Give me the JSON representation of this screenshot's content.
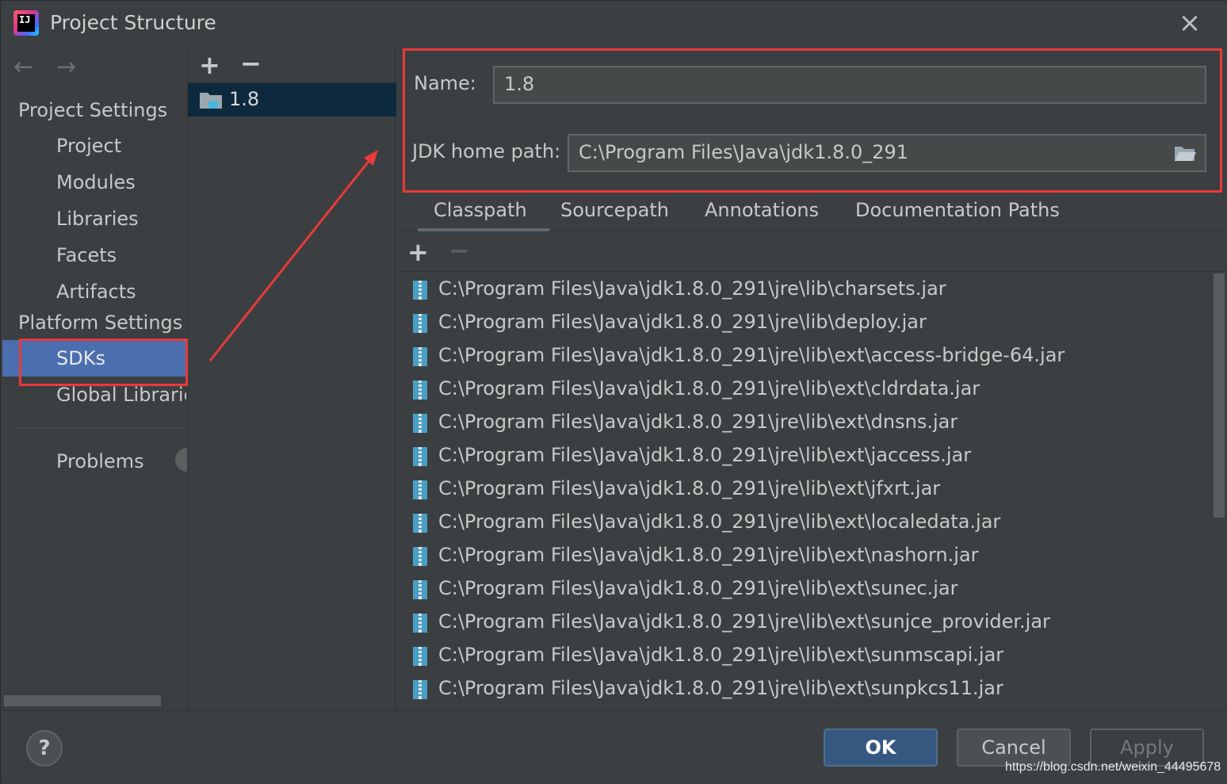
{
  "window": {
    "title": "Project Structure",
    "app_icon_text": "IJ"
  },
  "nav": {
    "back_arrow": "←",
    "forward_arrow": "→",
    "project_settings_header": "Project Settings",
    "project_items": [
      "Project",
      "Modules",
      "Libraries",
      "Facets",
      "Artifacts"
    ],
    "platform_settings_header": "Platform Settings",
    "sdks": "SDKs",
    "global_libraries": "Global Librarie",
    "problems": "Problems"
  },
  "sdk_list": {
    "add": "+",
    "remove": "−",
    "items": [
      "1.8"
    ]
  },
  "sdk_detail": {
    "name_label": "Name:",
    "name_value": "1.8",
    "jdk_label": "JDK home path:",
    "jdk_value": "C:\\Program Files\\Java\\jdk1.8.0_291"
  },
  "tabs": [
    "Classpath",
    "Sourcepath",
    "Annotations",
    "Documentation Paths"
  ],
  "classpath_toolbar": {
    "add": "+",
    "remove": "−"
  },
  "classpath": [
    "C:\\Program Files\\Java\\jdk1.8.0_291\\jre\\lib\\charsets.jar",
    "C:\\Program Files\\Java\\jdk1.8.0_291\\jre\\lib\\deploy.jar",
    "C:\\Program Files\\Java\\jdk1.8.0_291\\jre\\lib\\ext\\access-bridge-64.jar",
    "C:\\Program Files\\Java\\jdk1.8.0_291\\jre\\lib\\ext\\cldrdata.jar",
    "C:\\Program Files\\Java\\jdk1.8.0_291\\jre\\lib\\ext\\dnsns.jar",
    "C:\\Program Files\\Java\\jdk1.8.0_291\\jre\\lib\\ext\\jaccess.jar",
    "C:\\Program Files\\Java\\jdk1.8.0_291\\jre\\lib\\ext\\jfxrt.jar",
    "C:\\Program Files\\Java\\jdk1.8.0_291\\jre\\lib\\ext\\localedata.jar",
    "C:\\Program Files\\Java\\jdk1.8.0_291\\jre\\lib\\ext\\nashorn.jar",
    "C:\\Program Files\\Java\\jdk1.8.0_291\\jre\\lib\\ext\\sunec.jar",
    "C:\\Program Files\\Java\\jdk1.8.0_291\\jre\\lib\\ext\\sunjce_provider.jar",
    "C:\\Program Files\\Java\\jdk1.8.0_291\\jre\\lib\\ext\\sunmscapi.jar",
    "C:\\Program Files\\Java\\jdk1.8.0_291\\jre\\lib\\ext\\sunpkcs11.jar"
  ],
  "buttons": {
    "help": "?",
    "ok": "OK",
    "cancel": "Cancel",
    "apply": "Apply"
  },
  "watermark": "https://blog.csdn.net/weixin_44495678",
  "colors": {
    "background": "#3c3f41",
    "selection": "#4b6eaf",
    "list_selection": "#0d293e",
    "ok_button": "#365880",
    "annotation": "#e83a3a",
    "jar_icon": "#4a9fc4",
    "folder_icon": "#9aa7b0"
  }
}
